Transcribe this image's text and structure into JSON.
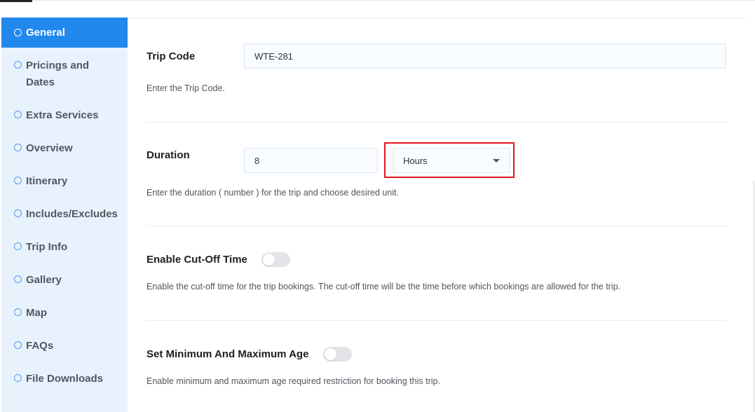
{
  "sidebar": {
    "items": [
      {
        "label": "General",
        "active": true
      },
      {
        "label": "Pricings and Dates"
      },
      {
        "label": "Extra Services"
      },
      {
        "label": "Overview"
      },
      {
        "label": "Itinerary"
      },
      {
        "label": "Includes/Excludes"
      },
      {
        "label": "Trip Info"
      },
      {
        "label": "Gallery"
      },
      {
        "label": "Map"
      },
      {
        "label": "FAQs"
      },
      {
        "label": "File Downloads"
      }
    ]
  },
  "fields": {
    "trip_code": {
      "label": "Trip Code",
      "value": "WTE-281",
      "help": "Enter the Trip Code."
    },
    "duration": {
      "label": "Duration",
      "value": "8",
      "unit": "Hours",
      "help": "Enter the duration ( number ) for the trip and choose desired unit."
    },
    "cutoff": {
      "label": "Enable Cut-Off Time",
      "enabled": false,
      "help": "Enable the cut-off time for the trip bookings. The cut-off time will be the time before which bookings are allowed for the trip."
    },
    "age": {
      "label": "Set Minimum And Maximum Age",
      "enabled": false,
      "help": "Enable minimum and maximum age required restriction for booking this trip."
    }
  },
  "colors": {
    "accent": "#2188ee",
    "sidebar_bg": "#e8f2fd",
    "highlight": "#e0161e"
  }
}
